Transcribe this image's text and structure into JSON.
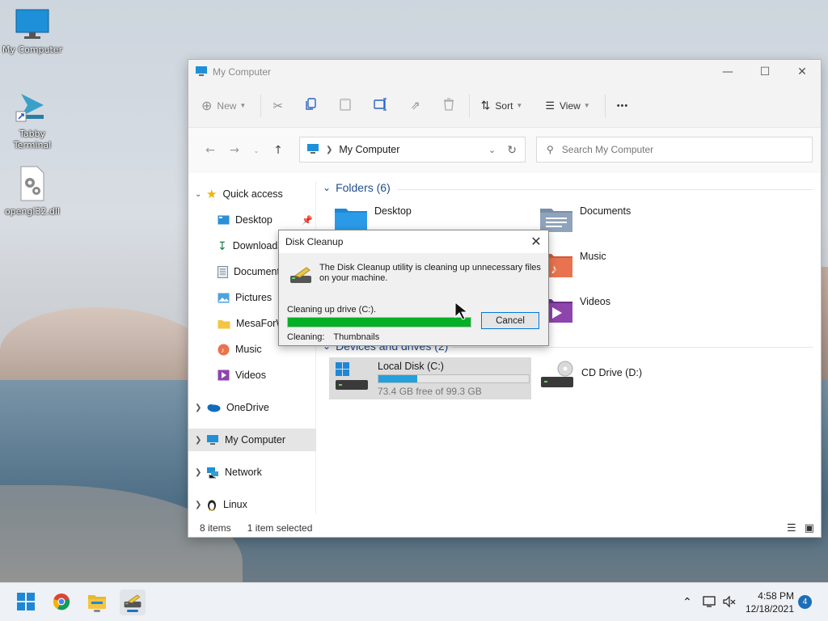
{
  "desktop": {
    "icons": [
      {
        "label": "My Computer"
      },
      {
        "label": "Tabby Terminal"
      },
      {
        "label": "opengl32.dll"
      }
    ]
  },
  "window": {
    "title": "My Computer",
    "toolbar": {
      "new_label": "New",
      "sort_label": "Sort",
      "view_label": "View",
      "more_label": "•••"
    },
    "address": {
      "path": "My Computer"
    },
    "search": {
      "placeholder": "Search My Computer"
    },
    "sidebar": {
      "quick_access": "Quick access",
      "items": [
        "Desktop",
        "Downloads",
        "Documents",
        "Pictures",
        "MesaForWindows",
        "Music",
        "Videos"
      ],
      "onedrive": "OneDrive",
      "my_computer": "My Computer",
      "network": "Network",
      "linux": "Linux"
    },
    "content": {
      "folders_header": "Folders (6)",
      "folders": [
        "Desktop",
        "Documents",
        "Downloads",
        "Music",
        "Pictures",
        "Videos"
      ],
      "devices_header": "Devices and drives (2)",
      "drives": [
        {
          "name": "Local Disk (C:)",
          "free": "73.4 GB free of 99.3 GB",
          "used_fraction": 0.26
        },
        {
          "name": "CD Drive (D:)"
        }
      ]
    },
    "status": {
      "items": "8 items",
      "selected": "1 item selected"
    }
  },
  "dialog": {
    "title": "Disk Cleanup",
    "message": "The Disk Cleanup utility is cleaning up unnecessary files on your machine.",
    "drive_text": "Cleaning up drive  (C:).",
    "progress_fraction": 1.0,
    "cancel_label": "Cancel",
    "cleaning_label": "Cleaning:",
    "cleaning_item": "Thumbnails"
  },
  "taskbar": {
    "time": "4:58 PM",
    "date": "12/18/2021",
    "notification_count": "4"
  },
  "colors": {
    "accent": "#0078d7",
    "progress_green": "#06b025",
    "drive_bar": "#26a0da"
  }
}
